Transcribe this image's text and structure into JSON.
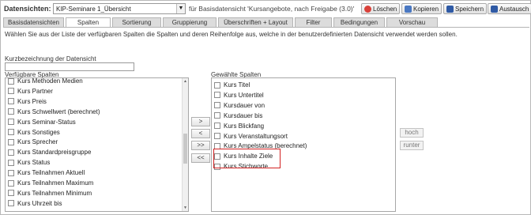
{
  "header": {
    "datasource_label": "Datensichten:",
    "datasource_value": "KIP-Seminare 1_Übersicht",
    "info": "für Basisdatensicht 'Kursangebote, nach Freigabe (3.0)'",
    "buttons": [
      {
        "label": "Löschen",
        "icon": "delete-icon",
        "color": "#d9413a"
      },
      {
        "label": "Kopieren",
        "icon": "copy-icon",
        "color": "#4a78c2"
      },
      {
        "label": "Speichern",
        "icon": "save-icon",
        "color": "#2f5aa5"
      },
      {
        "label": "Austausch",
        "icon": "exchange-icon",
        "color": "#2f5aa5"
      }
    ]
  },
  "tabs": [
    {
      "label": "Basisdatensichten",
      "active": false
    },
    {
      "label": "Spalten",
      "active": true
    },
    {
      "label": "Sortierung",
      "active": false
    },
    {
      "label": "Gruppierung",
      "active": false
    },
    {
      "label": "Überschriften + Layout",
      "active": false
    },
    {
      "label": "Filter",
      "active": false
    },
    {
      "label": "Bedingungen",
      "active": false
    },
    {
      "label": "Vorschau",
      "active": false
    }
  ],
  "hint": "Wählen Sie aus der Liste der verfügbaren Spalten die Spalten und deren Reihenfolge aus, welche in der benutzerdefinierten Datensicht verwendet werden sollen.",
  "short_name": {
    "label": "Kurzbezeichnung der Datensicht",
    "value": ""
  },
  "available": {
    "label": "Verfügbare Spalten",
    "items": [
      "Kurs Methoden Medien",
      "Kurs Partner",
      "Kurs Preis",
      "Kurs Schwellwert (berechnet)",
      "Kurs Seminar-Status",
      "Kurs Sonstiges",
      "Kurs Sprecher",
      "Kurs Standardpreisgruppe",
      "Kurs Status",
      "Kurs Teilnahmen Aktuell",
      "Kurs Teilnahmen Maximum",
      "Kurs Teilnahmen Minimum",
      "Kurs Uhrzeit bis"
    ]
  },
  "move_buttons": [
    ">",
    "<",
    ">>",
    "<<"
  ],
  "selected": {
    "label": "Gewählte Spalten",
    "items": [
      "Kurs Titel",
      "Kurs Untertitel",
      "Kursdauer von",
      "Kursdauer bis",
      "Kurs Blickfang",
      "Kurs Veranstaltungsort",
      "Kurs Ampelstatus (berechnet)",
      "Kurs Inhalte Ziele",
      "Kurs Stichworte"
    ]
  },
  "order_buttons": [
    "hoch",
    "runter"
  ],
  "highlight_color": "#d22222"
}
